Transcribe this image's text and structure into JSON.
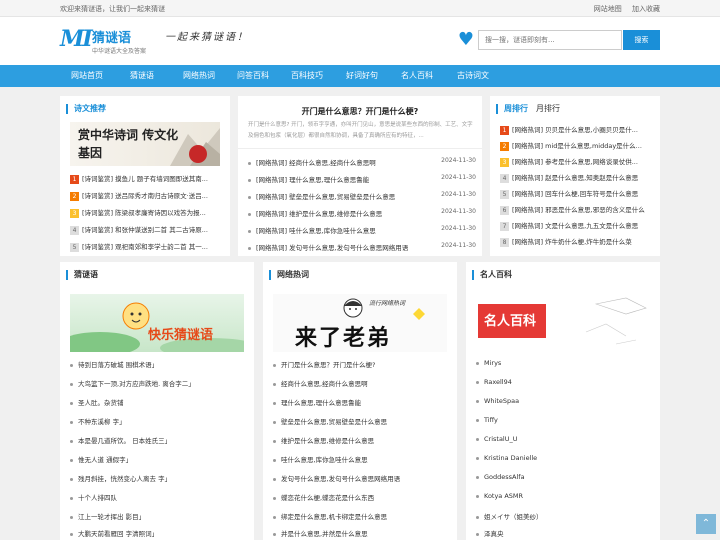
{
  "topbar": {
    "welcome": "欢迎来猜谜语，让我们一起来猜谜",
    "sitemap": "网站地图",
    "favorite": "加入收藏"
  },
  "header": {
    "logo_mark": "MI",
    "logo_name": "猜谜语",
    "logo_sub": "中华谜语大全及答案",
    "slogan": "一起来猜谜语！",
    "search_placeholder": "搜一搜，谜语即刻有...",
    "search_button": "搜索"
  },
  "nav": [
    "网站首页",
    "猜谜语",
    "网络热词",
    "问答百科",
    "百科技巧",
    "好词好句",
    "名人百科",
    "古诗词文"
  ],
  "poem": {
    "title": "诗文推荐",
    "banner_text": "赏中华诗词 传文化基因",
    "items": [
      "[诗词鉴赏] 摸鱼儿 题子有墙词图即送其南...",
      "[诗词鉴赏] 送吕际秀才南归古诗原文·送吕...",
      "[诗词鉴赏] 陈梁叔孝廉寄诗因以戏答为报...",
      "[诗词鉴赏] 和张仲谋送别二首 其二古诗原...",
      "[诗词鉴赏] 观祀南郊和李学士韵二首 其一..."
    ]
  },
  "center": {
    "title": "开门是什么意思？开门是什么梗?",
    "desc": "开门是什么意思? 开门，领币字亨通，亦叫开门见山，意思是说某些东西的形制、工艺、文字及佣色和包浆（氧化层）都很自然和协调，具备了真确所应有的特征，...",
    "items": [
      {
        "text": "[网络热词] 经商什么意思,经商什么意思啊",
        "date": "2024-11-30"
      },
      {
        "text": "[网络热词] 理什么意思,理什么意思鲁能",
        "date": "2024-11-30"
      },
      {
        "text": "[网络热词] 壁垒是什么意思,贸易壁垒是什么意思",
        "date": "2024-11-30"
      },
      {
        "text": "[网络热词] 维护是什么意思,维修是什么意思",
        "date": "2024-11-30"
      },
      {
        "text": "[网络热词] 哇什么意思,库你急哇什么意思",
        "date": "2024-11-30"
      },
      {
        "text": "[网络热词] 发句号什么意思,发句号什么意思网络用语",
        "date": "2024-11-30"
      }
    ]
  },
  "ranking": {
    "tab_week": "周排行",
    "tab_month": "月排行",
    "items": [
      "[网络热词] 贝贝是什么意思,小圈贝贝是什...",
      "[网络热词] mid是什么意思,midday是什么...",
      "[网络热词] 参考是什么意思,网络谈录仗供...",
      "[网络热词] 赵是什么意思,知奥赵是什么意思",
      "[网络热词] 回车什么梗,回车符号是什么意思",
      "[网络热词] 邪恶是什么意思,邪恶的含义是什么",
      "[网络热词] 文是什么意思,九五文是什么意思",
      "[网络热词] 炸牛奶什么梗,炸牛奶是什么菜"
    ]
  },
  "riddle": {
    "title": "猜谜语",
    "banner_text": "快乐猜谜语",
    "items": [
      "待到日落方破城 围棋术语」",
      "大鸟篮下一顶,对方应声跌地. 离合字二」",
      "圣人肚。杂货铺",
      "不种东溪柳 字」",
      "本是晏几道所饮。 日本姓氏三」",
      "惟无人道 通假字」",
      "残月斜挂，恍然变心人离去 字」",
      "十个人排四队",
      "江上一轮才挥出 影目」",
      "大鹏天前看雁回 字清照词」"
    ]
  },
  "hotword": {
    "title": "网络热词",
    "banner_top": "流行网络热词",
    "banner_text": "来了老弟",
    "items": [
      "开门是什么意思？开门是什么梗?",
      "经商什么意思,经商什么意思啊",
      "理什么意思,理什么意思鲁能",
      "壁垒是什么意思,贸易壁垒是什么意思",
      "维护是什么意思,维修是什么意思",
      "哇什么意思,库你急哇什么意思",
      "发句号什么意思,发句号什么意思网络用语",
      "蝶恋花什么梗,蝶恋花是什么东西",
      "绑定是什么意思,机卡绑定是什么意思",
      "并是什么意思,并然是什么意思"
    ]
  },
  "celebrity": {
    "title": "名人百科",
    "banner_text": "名人百科",
    "items": [
      "Mirys",
      "Raxell94",
      "WhiteSpaa",
      "Tiffy",
      "CristalU_U",
      "Kristina Danielle",
      "GoddessAlfa",
      "Kotya ASMR",
      "姐メイサ（姐美纱）",
      "泽真央"
    ]
  }
}
